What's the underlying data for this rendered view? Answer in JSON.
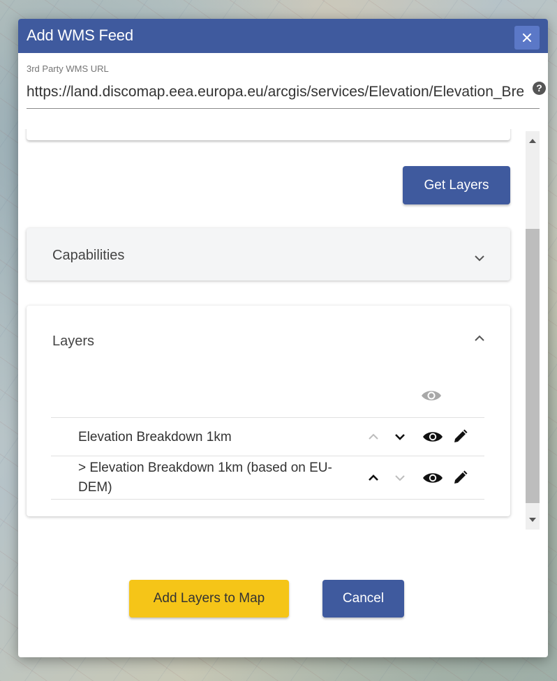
{
  "dialog": {
    "title": "Add WMS Feed",
    "close_glyph": "×"
  },
  "url": {
    "label": "3rd Party WMS URL",
    "value": "https://land.discomap.eea.europa.eu/arcgis/services/Elevation/Elevation_Breakdown/MapServer/WMSServer",
    "help_icon": "question-circle-icon",
    "help_glyph": "?"
  },
  "actions": {
    "get_layers_label": "Get Layers",
    "add_layers_label": "Add Layers to Map",
    "cancel_label": "Cancel"
  },
  "panels": {
    "capabilities": {
      "title": "Capabilities",
      "expanded": false
    },
    "layers": {
      "title": "Layers",
      "expanded": true
    }
  },
  "layers": [
    {
      "name": "Elevation Breakdown 1km",
      "move_up_enabled": false,
      "move_down_enabled": true,
      "visible": true
    },
    {
      "name": "> Elevation Breakdown 1km (based on EU-DEM)",
      "move_up_enabled": true,
      "move_down_enabled": false,
      "visible": true
    }
  ],
  "icons": {
    "eye": "eye-icon",
    "pencil": "pencil-icon",
    "chevron_up": "chevron-up-icon",
    "chevron_down": "chevron-down-icon"
  },
  "colors": {
    "header": "#3f5a9e",
    "close_button": "#5b78c7",
    "primary_button": "#3f5a9e",
    "add_button": "#f5c518",
    "icon_active": "#111111",
    "icon_disabled": "#bdbdbd",
    "eye_header": "#a8a8a8"
  }
}
